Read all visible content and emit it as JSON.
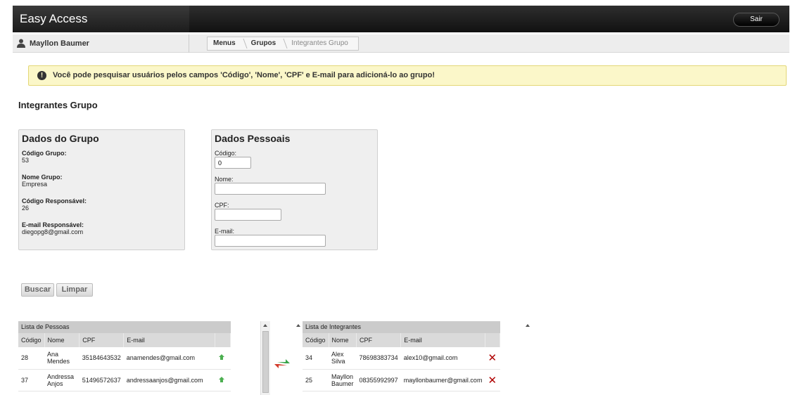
{
  "app": {
    "title": "Easy Access",
    "logout_label": "Sair"
  },
  "user": {
    "name": "Mayllon Baumer"
  },
  "breadcrumb": [
    "Menus",
    "Grupos",
    "Integrantes Grupo"
  ],
  "alert": {
    "text": "Você pode pesquisar usuários pelos campos 'Código', 'Nome', 'CPF' e E-mail para adicioná-lo ao grupo!"
  },
  "page": {
    "title": "Integrantes Grupo"
  },
  "grupo": {
    "title": "Dados do Grupo",
    "codigo_label": "Código Grupo:",
    "codigo": "53",
    "nome_label": "Nome Grupo:",
    "nome": "Empresa",
    "resp_label": "Código Responsável:",
    "resp": "26",
    "email_label": "E-mail Responsável:",
    "email": "diegopg8@gmail.com"
  },
  "pessoais": {
    "title": "Dados Pessoais",
    "codigo_label": "Código:",
    "codigo_value": "0",
    "nome_label": "Nome:",
    "nome_value": "",
    "cpf_label": "CPF:",
    "cpf_value": "",
    "email_label": "E-mail:",
    "email_value": ""
  },
  "actions": {
    "buscar": "Buscar",
    "limpar": "Limpar"
  },
  "pessoas": {
    "title": "Lista de Pessoas",
    "columns": [
      "Código",
      "Nome",
      "CPF",
      "E-mail"
    ],
    "rows": [
      {
        "codigo": "28",
        "nome": "Ana Mendes",
        "cpf": "35184643532",
        "email": "anamendes@gmail.com"
      },
      {
        "codigo": "37",
        "nome": "Andressa Anjos",
        "cpf": "51496572637",
        "email": "andressaanjos@gmail.com"
      }
    ]
  },
  "integrantes": {
    "title": "Lista de Integrantes",
    "columns": [
      "Código",
      "Nome",
      "CPF",
      "E-mail"
    ],
    "rows": [
      {
        "codigo": "34",
        "nome": "Alex Silva",
        "cpf": "78698383734",
        "email": "alex10@gmail.com"
      },
      {
        "codigo": "25",
        "nome": "Mayllon Baumer",
        "cpf": "08355992997",
        "email": "mayllonbaumer@gmail.com"
      }
    ]
  },
  "colors": {
    "alert_bg": "#fbf7c9",
    "add_green": "#4caf50",
    "delete_red": "#b00000"
  },
  "icons": {
    "user": "user-icon",
    "alert": "exclamation-icon",
    "add": "add-icon",
    "delete": "close-icon",
    "swap": "swap-arrows-icon"
  }
}
